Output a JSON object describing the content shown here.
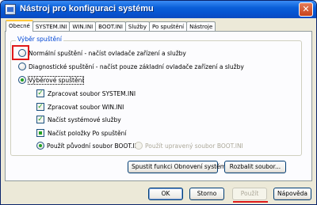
{
  "window": {
    "title": "Nástroj pro konfiguraci systému",
    "close_glyph": "✕"
  },
  "tabs": [
    {
      "label": "Obecné",
      "active": true
    },
    {
      "label": "SYSTEM.INI"
    },
    {
      "label": "WIN.INI"
    },
    {
      "label": "BOOT.INI"
    },
    {
      "label": "Služby"
    },
    {
      "label": "Po spuštění"
    },
    {
      "label": "Nástroje"
    }
  ],
  "startup_group": {
    "legend": "Výběr spuštění",
    "normal": "Normální spuštění - načíst ovladače zařízení a služby",
    "diagnostic": "Diagnostické spuštění - načíst pouze základní ovladače zařízení a služby",
    "selective": "Výběrové spuštění",
    "options": {
      "system_ini": "Zpracovat soubor SYSTEM.INI",
      "win_ini": "Zpracovat soubor WIN.INI",
      "services": "Načíst systémové služby",
      "startup_items": "Načíst položky Po spuštění",
      "boot_original": "Použít původní soubor BOOT.INI",
      "boot_modified": "Použít upravený soubor BOOT.INI"
    },
    "checked_glyph": "✓"
  },
  "panel_buttons": {
    "restore": "Spustit funkci Obnovení systému",
    "expand": "Rozbalit soubor..."
  },
  "dialog_buttons": {
    "ok": "OK",
    "cancel": "Storno",
    "apply": "Použít",
    "help": "Nápověda"
  },
  "colors": {
    "titlebar": "#0654d1",
    "annotation": "#e01a1a",
    "radio_dot": "#21a121"
  }
}
